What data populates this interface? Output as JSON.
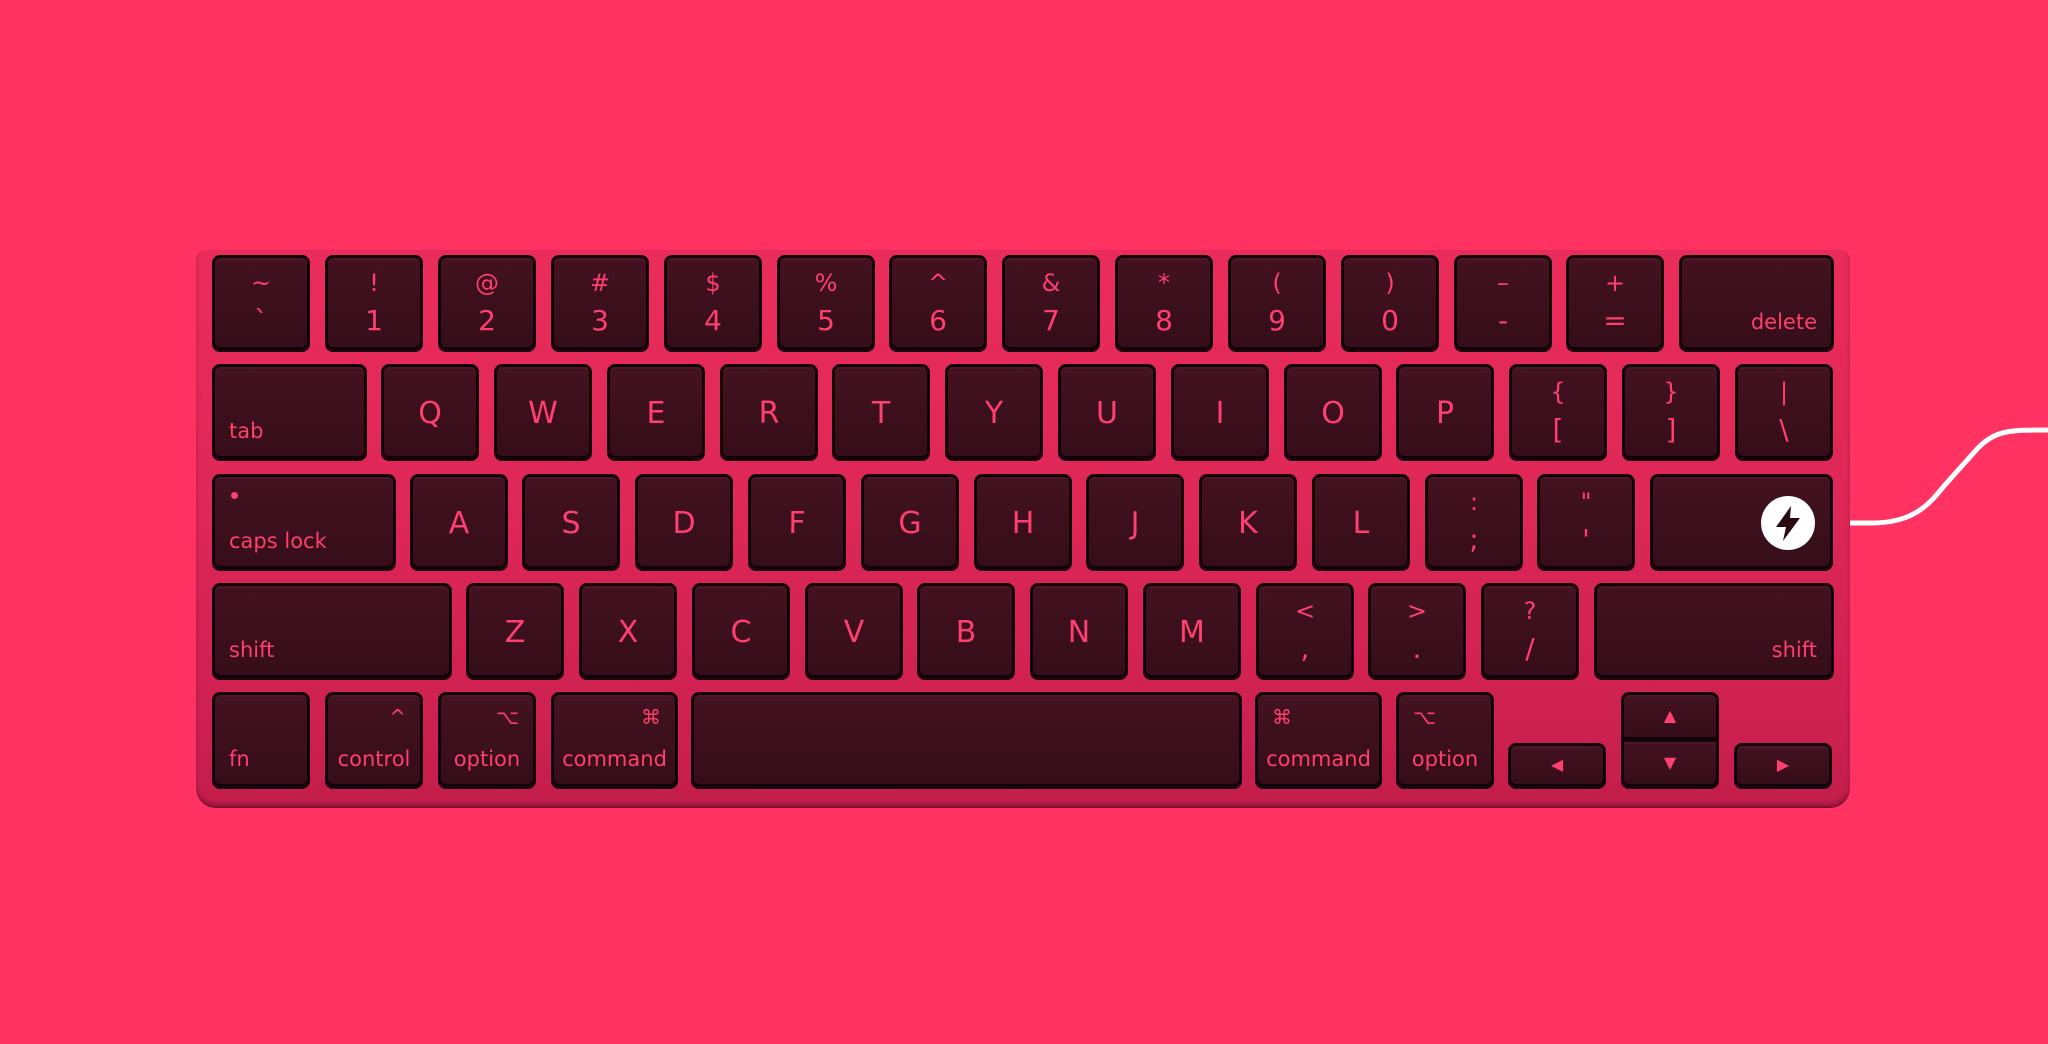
{
  "background_color": "#ff3262",
  "keycap_color": "#3c0f1c",
  "legend_color": "#ff3f6f",
  "cable_color": "#ffffff",
  "rows": [
    [
      {
        "name": "key-tilde",
        "upper": "~",
        "main": "`",
        "type": "pair"
      },
      {
        "name": "key-1",
        "upper": "!",
        "main": "1",
        "type": "pair"
      },
      {
        "name": "key-2",
        "upper": "@",
        "main": "2",
        "type": "pair"
      },
      {
        "name": "key-3",
        "upper": "#",
        "main": "3",
        "type": "pair"
      },
      {
        "name": "key-4",
        "upper": "$",
        "main": "4",
        "type": "pair"
      },
      {
        "name": "key-5",
        "upper": "%",
        "main": "5",
        "type": "pair"
      },
      {
        "name": "key-6",
        "upper": "^",
        "main": "6",
        "type": "pair"
      },
      {
        "name": "key-7",
        "upper": "&",
        "main": "7",
        "type": "pair"
      },
      {
        "name": "key-8",
        "upper": "*",
        "main": "8",
        "type": "pair"
      },
      {
        "name": "key-9",
        "upper": "(",
        "main": "9",
        "type": "pair"
      },
      {
        "name": "key-0",
        "upper": ")",
        "main": "0",
        "type": "pair"
      },
      {
        "name": "key-minus",
        "upper": "–",
        "main": "-",
        "type": "pair"
      },
      {
        "name": "key-equals",
        "upper": "+",
        "main": "=",
        "type": "pair"
      },
      {
        "name": "key-delete",
        "label": "delete",
        "type": "label-right"
      }
    ],
    [
      {
        "name": "key-tab",
        "label": "tab",
        "type": "label-left"
      },
      {
        "name": "key-q",
        "main": "Q",
        "type": "letter"
      },
      {
        "name": "key-w",
        "main": "W",
        "type": "letter"
      },
      {
        "name": "key-e",
        "main": "E",
        "type": "letter"
      },
      {
        "name": "key-r",
        "main": "R",
        "type": "letter"
      },
      {
        "name": "key-t",
        "main": "T",
        "type": "letter"
      },
      {
        "name": "key-y",
        "main": "Y",
        "type": "letter"
      },
      {
        "name": "key-u",
        "main": "U",
        "type": "letter"
      },
      {
        "name": "key-i",
        "main": "I",
        "type": "letter"
      },
      {
        "name": "key-o",
        "main": "O",
        "type": "letter"
      },
      {
        "name": "key-p",
        "main": "P",
        "type": "letter"
      },
      {
        "name": "key-left-bracket",
        "upper": "{",
        "main": "[",
        "type": "pair"
      },
      {
        "name": "key-right-bracket",
        "upper": "}",
        "main": "]",
        "type": "pair"
      },
      {
        "name": "key-backslash",
        "upper": "|",
        "main": "\\",
        "type": "pair"
      }
    ],
    [
      {
        "name": "key-caps-lock",
        "label": "caps lock",
        "type": "caps"
      },
      {
        "name": "key-a",
        "main": "A",
        "type": "letter"
      },
      {
        "name": "key-s",
        "main": "S",
        "type": "letter"
      },
      {
        "name": "key-d",
        "main": "D",
        "type": "letter"
      },
      {
        "name": "key-f",
        "main": "F",
        "type": "letter"
      },
      {
        "name": "key-g",
        "main": "G",
        "type": "letter"
      },
      {
        "name": "key-h",
        "main": "H",
        "type": "letter"
      },
      {
        "name": "key-j",
        "main": "J",
        "type": "letter"
      },
      {
        "name": "key-k",
        "main": "K",
        "type": "letter"
      },
      {
        "name": "key-l",
        "main": "L",
        "type": "letter"
      },
      {
        "name": "key-semicolon",
        "upper": ":",
        "main": ";",
        "type": "pair"
      },
      {
        "name": "key-quote",
        "upper": "\"",
        "main": "'",
        "type": "pair"
      },
      {
        "name": "key-return",
        "label": "",
        "type": "blank"
      }
    ],
    [
      {
        "name": "key-shift-left",
        "label": "shift",
        "type": "label-left"
      },
      {
        "name": "key-z",
        "main": "Z",
        "type": "letter"
      },
      {
        "name": "key-x",
        "main": "X",
        "type": "letter"
      },
      {
        "name": "key-c",
        "main": "C",
        "type": "letter"
      },
      {
        "name": "key-v",
        "main": "V",
        "type": "letter"
      },
      {
        "name": "key-b",
        "main": "B",
        "type": "letter"
      },
      {
        "name": "key-n",
        "main": "N",
        "type": "letter"
      },
      {
        "name": "key-m",
        "main": "M",
        "type": "letter"
      },
      {
        "name": "key-comma",
        "upper": "<",
        "main": ",",
        "type": "pair"
      },
      {
        "name": "key-period",
        "upper": ">",
        "main": ".",
        "type": "pair"
      },
      {
        "name": "key-slash",
        "upper": "?",
        "main": "/",
        "type": "pair"
      },
      {
        "name": "key-shift-right",
        "label": "shift",
        "type": "label-right"
      }
    ],
    [
      {
        "name": "key-fn",
        "label": "fn",
        "type": "label-left"
      },
      {
        "name": "key-control",
        "label": "control",
        "symbol": "^",
        "type": "mod-right-symbol"
      },
      {
        "name": "key-option-left",
        "label": "option",
        "symbol": "⌥",
        "type": "mod-right-symbol"
      },
      {
        "name": "key-command-left",
        "label": "command",
        "symbol": "⌘",
        "type": "mod-right-symbol"
      },
      {
        "name": "key-space",
        "label": "",
        "type": "blank"
      },
      {
        "name": "key-command-right",
        "label": "command",
        "symbol": "⌘",
        "type": "mod-left-symbol"
      },
      {
        "name": "key-option-right",
        "label": "option",
        "symbol": "⌥",
        "type": "mod-left-symbol"
      }
    ]
  ],
  "arrows": {
    "left": "◀",
    "up": "▲",
    "down": "▼",
    "right": "▶"
  },
  "power_badge_icon": "lightning-bolt-icon"
}
